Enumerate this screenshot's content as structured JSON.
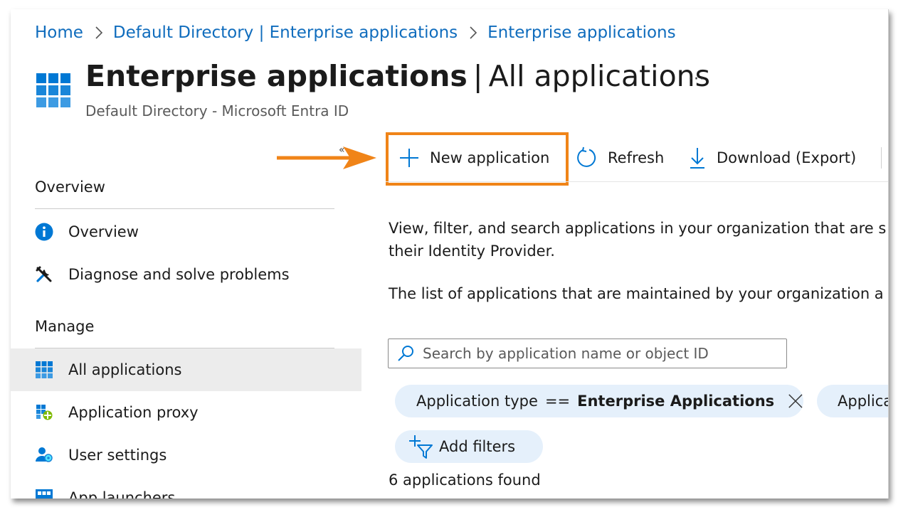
{
  "breadcrumb": {
    "items": [
      "Home",
      "Default Directory | Enterprise applications",
      "Enterprise applications"
    ]
  },
  "header": {
    "title_bold": "Enterprise applications",
    "title_separator": "|",
    "title_rest": "All applications",
    "subtitle": "Default Directory - Microsoft Entra ID",
    "more_label": "···"
  },
  "sidebar": {
    "collapse_label": "«",
    "sections": [
      {
        "heading": "Overview",
        "items": [
          {
            "label": "Overview",
            "icon": "info-icon"
          },
          {
            "label": "Diagnose and solve problems",
            "icon": "wrench-icon"
          }
        ]
      },
      {
        "heading": "Manage",
        "items": [
          {
            "label": "All applications",
            "icon": "grid-icon",
            "selected": true
          },
          {
            "label": "Application proxy",
            "icon": "app-proxy-icon"
          },
          {
            "label": "User settings",
            "icon": "user-settings-icon"
          },
          {
            "label": "App launchers",
            "icon": "app-launcher-icon"
          }
        ]
      }
    ]
  },
  "toolbar": {
    "new_application": "New application",
    "refresh": "Refresh",
    "download": "Download (Export)"
  },
  "content": {
    "description_line1": "View, filter, and search applications in your organization that are s",
    "description_line2": "their Identity Provider.",
    "description_line3": "The list of applications that are maintained by your organization a",
    "search_placeholder": "Search by application name or object ID",
    "filters": [
      {
        "field": "Application type",
        "operator": "==",
        "value": "Enterprise Applications"
      },
      {
        "field": "Applica",
        "operator": "",
        "value": ""
      }
    ],
    "add_filters": "Add filters",
    "result_count": "6 applications found"
  },
  "colors": {
    "link": "#0f6cbd",
    "accent": "#0078d4",
    "highlight": "#f08418",
    "selected_bg": "#ececec",
    "pill_bg": "#e5f0fb"
  }
}
